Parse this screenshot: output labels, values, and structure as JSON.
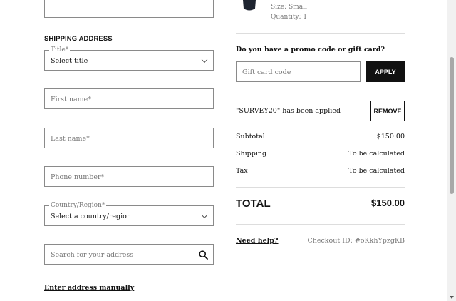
{
  "shipping": {
    "section_title": "SHIPPING ADDRESS",
    "title_field": {
      "label": "Title*",
      "value": "Select title"
    },
    "first_name": {
      "placeholder": "First name*"
    },
    "last_name": {
      "placeholder": "Last name*"
    },
    "phone": {
      "placeholder": "Phone number*"
    },
    "country_field": {
      "label": "Country/Region*",
      "value": "Select a country/region"
    },
    "address_search": {
      "placeholder": "Search for your address"
    },
    "manual_link": "Enter address manually"
  },
  "item": {
    "size": "Size: Small",
    "quantity": "Quantity: 1"
  },
  "promo": {
    "question": "Do you have a promo code or gift card?",
    "placeholder": "Gift card code",
    "apply_label": "APPLY",
    "applied_text": "\"SURVEY20\" has been applied",
    "remove_label": "REMOVE"
  },
  "summary": {
    "rows": [
      {
        "label": "Subtotal",
        "value": "$150.00"
      },
      {
        "label": "Shipping",
        "value": "To be calculated"
      },
      {
        "label": "Tax",
        "value": "To be calculated"
      }
    ],
    "total_label": "TOTAL",
    "total_value": "$150.00"
  },
  "footer": {
    "help_link": "Need help?",
    "checkout_id": "Checkout ID: #oKkhYpzgKB"
  },
  "colors": {
    "accent": "#111111",
    "border": "#8a8a8a",
    "muted": "#777777"
  }
}
